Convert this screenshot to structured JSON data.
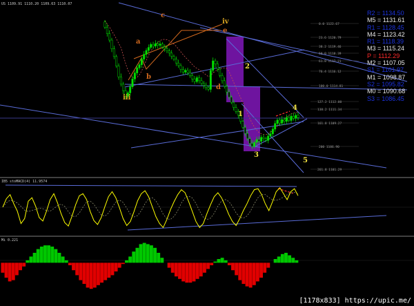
{
  "header": {
    "main": "US 1109.91 1110.20 1109.63 1110.07",
    "panel2": "IB5  stoMACD(4) 11.9574",
    "panel3": "Mi  0.221"
  },
  "pivot_levels": [
    {
      "label": "R2 = 1134.50",
      "color": "#1c33e0"
    },
    {
      "label": "M5 = 1131.61",
      "color": "#e8e8e8"
    },
    {
      "label": "R1 = 1128.45",
      "color": "#1c33e0"
    },
    {
      "label": "M4 = 1123.42",
      "color": "#e8e8e8"
    },
    {
      "label": "R1 = 1118.39",
      "color": "#1c33e0"
    },
    {
      "label": "M3 = 1115.24",
      "color": "#e8e8e8"
    },
    {
      "label": "P   = 1112.29",
      "color": "#ff2a2a"
    },
    {
      "label": "M2 = 1107.05",
      "color": "#e8e8e8"
    },
    {
      "label": "S1 = 1101.97",
      "color": "#1c33e0"
    },
    {
      "label": "M1 = 1098.87",
      "color": "#e8e8e8"
    },
    {
      "label": "S2 = 1095.82",
      "color": "#1c33e0"
    },
    {
      "label": "M0 = 1090.68",
      "color": "#e8e8e8"
    },
    {
      "label": "S3 = 1086.45",
      "color": "#1c33e0"
    }
  ],
  "wave_labels": [
    {
      "text": "a",
      "color": "#d2691e"
    },
    {
      "text": "b",
      "color": "#d2691e"
    },
    {
      "text": "c",
      "color": "#d2691e"
    },
    {
      "text": "d",
      "color": "#d2691e"
    },
    {
      "text": "e",
      "color": "#d2691e"
    },
    {
      "text": "iii",
      "color": "#daa520"
    },
    {
      "text": "iv",
      "color": "#daa520"
    },
    {
      "text": "1",
      "color": "#f0e040"
    },
    {
      "text": "2",
      "color": "#f0e040"
    },
    {
      "text": "3",
      "color": "#f0e040"
    },
    {
      "text": "4",
      "color": "#f0e040"
    },
    {
      "text": "5",
      "color": "#f0e040"
    }
  ],
  "fib_labels": [
    "0.0 1122.67",
    "23.6 1120.79",
    "38.2 1119.46",
    "50.0 1118.39",
    "61.8 1117.21",
    "76.4 1116.12",
    "100.0 1114.81",
    "127.2 1112.00",
    "138.2 1111.34",
    "161.8 1109.27",
    "200 1106.90",
    "261.8 1101.29"
  ],
  "colors": {
    "background": "#000000",
    "bull_candle": "#00e000",
    "bear_candle": "#00c000",
    "trendline": "#5a6cd8",
    "oscillator": "#ffff00",
    "signal": "#8c8c6e",
    "histogram_positive": "#00c800",
    "histogram_negative": "#e10000",
    "highlight_box": "#7a16b0",
    "dashed_ma": "#c85050"
  },
  "chart_data": [
    {
      "type": "candlestick",
      "title": "US",
      "ohlc_last": {
        "open": 1109.91,
        "high": 1110.2,
        "low": 1109.63,
        "close": 1110.07
      },
      "close_series": [
        1131.0,
        1129.5,
        1128.0,
        1126.0,
        1124.2,
        1122.0,
        1119.5,
        1117.8,
        1116.3,
        1115.0,
        1115.8,
        1117.2,
        1119.0,
        1120.4,
        1121.6,
        1122.3,
        1123.6,
        1124.7,
        1125.6,
        1126.3,
        1127.0,
        1126.6,
        1127.2,
        1126.8,
        1127.1,
        1126.4,
        1126.0,
        1125.5,
        1125.0,
        1124.2,
        1123.6,
        1122.7,
        1122.1,
        1121.2,
        1120.6,
        1121.0,
        1120.5,
        1119.8,
        1119.0,
        1118.4,
        1119.3,
        1118.6,
        1118.0,
        1117.5,
        1117.0,
        1116.6,
        1121.0,
        1123.2,
        1122.5,
        1121.3,
        1119.8,
        1118.6,
        1117.3,
        1116.0,
        1114.8,
        1113.6,
        1112.4,
        1111.5,
        1110.6,
        1109.2,
        1107.8,
        1106.4,
        1105.2,
        1104.1,
        1103.4,
        1104.3,
        1105.0,
        1104.6,
        1105.5,
        1105.2,
        1104.8,
        1105.8,
        1106.3,
        1107.4,
        1108.7,
        1109.5,
        1108.8,
        1109.6,
        1109.2,
        1110.1,
        1109.4,
        1110.4,
        1109.9,
        1110.6,
        1110.07
      ],
      "y_range": [
        1097,
        1136
      ]
    },
    {
      "type": "line",
      "title": "IB5 stoMACD(4) 11.9574",
      "series_name": "stoMACD",
      "values": [
        3,
        20,
        28,
        10,
        -5,
        -30,
        -20,
        15,
        22,
        5,
        -18,
        -25,
        -5,
        18,
        30,
        12,
        -10,
        -28,
        -35,
        -15,
        8,
        26,
        30,
        18,
        -6,
        -24,
        -32,
        -18,
        4,
        24,
        34,
        22,
        2,
        -20,
        -34,
        -26,
        -6,
        16,
        30,
        36,
        24,
        4,
        -16,
        -30,
        -38,
        -22,
        -2,
        14,
        28,
        38,
        32,
        14,
        -6,
        -26,
        -38,
        -30,
        -10,
        8,
        24,
        32,
        22,
        6,
        -12,
        -26,
        -34,
        -20,
        -4,
        10,
        26,
        38,
        40,
        28,
        10,
        -4,
        14,
        34,
        42,
        30,
        18,
        34,
        40,
        26
      ],
      "y_range": [
        -50,
        50
      ]
    },
    {
      "type": "bar",
      "title": "Mi 0.221",
      "values": [
        -8,
        -12,
        -15,
        -14,
        -10,
        -6,
        -3,
        2,
        5,
        8,
        11,
        13,
        14,
        14,
        13,
        11,
        8,
        5,
        2,
        -2,
        -6,
        -10,
        -14,
        -17,
        -20,
        -21,
        -20,
        -18,
        -16,
        -14,
        -12,
        -10,
        -7,
        -4,
        -1,
        2,
        5,
        9,
        12,
        15,
        16,
        15,
        14,
        12,
        8,
        4,
        0,
        -4,
        -8,
        -11,
        -13,
        -15,
        -16,
        -16,
        -15,
        -13,
        -11,
        -8,
        -5,
        -2,
        1,
        3,
        4,
        2,
        -2,
        -6,
        -10,
        -14,
        -17,
        -19,
        -20,
        -18,
        -15,
        -12,
        -8,
        -4,
        0,
        3,
        5,
        7,
        8,
        6,
        4,
        2
      ],
      "y_range": [
        -22,
        18
      ]
    }
  ],
  "watermark": "[1178x833] https://upic.me/"
}
